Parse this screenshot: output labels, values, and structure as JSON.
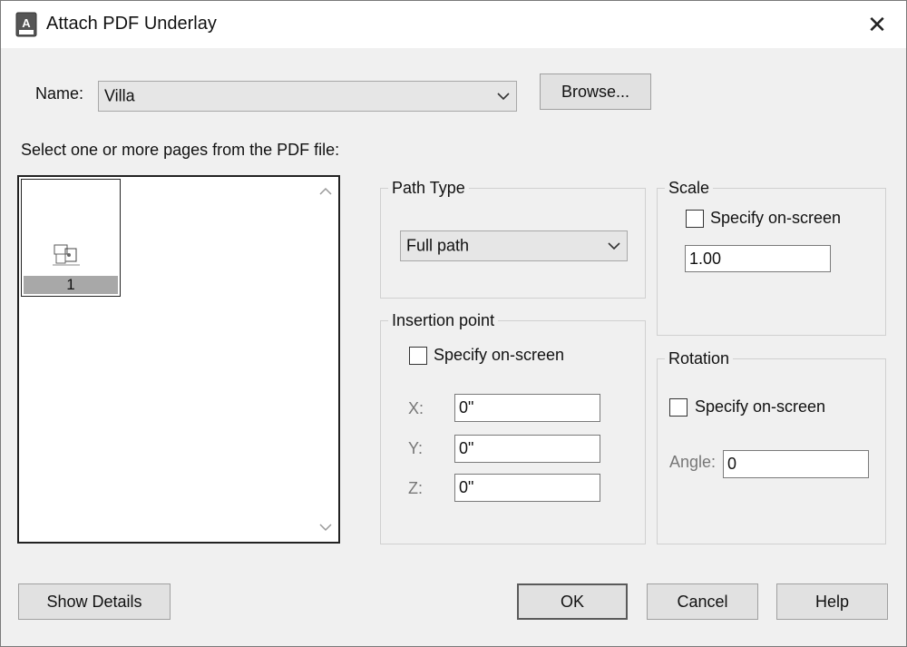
{
  "window": {
    "title": "Attach PDF Underlay",
    "close_icon": "close-icon",
    "app_icon": "autocad-dwg-icon"
  },
  "name_field": {
    "label": "Name:",
    "value": "Villa"
  },
  "browse_button": {
    "label": "Browse..."
  },
  "pages": {
    "prompt": "Select one or more pages from the PDF file:",
    "items": [
      {
        "label": "1"
      }
    ]
  },
  "path_type": {
    "title": "Path Type",
    "value": "Full path"
  },
  "scale": {
    "title": "Scale",
    "specify_label": "Specify on-screen",
    "value": "1.00"
  },
  "insertion_point": {
    "title": "Insertion point",
    "specify_label": "Specify on-screen",
    "x_label": "X:",
    "x_value": "0\"",
    "y_label": "Y:",
    "y_value": "0\"",
    "z_label": "Z:",
    "z_value": "0\""
  },
  "rotation": {
    "title": "Rotation",
    "specify_label": "Specify on-screen",
    "angle_label": "Angle:",
    "angle_value": "0"
  },
  "buttons": {
    "show_details": "Show Details",
    "ok": "OK",
    "cancel": "Cancel",
    "help": "Help"
  }
}
